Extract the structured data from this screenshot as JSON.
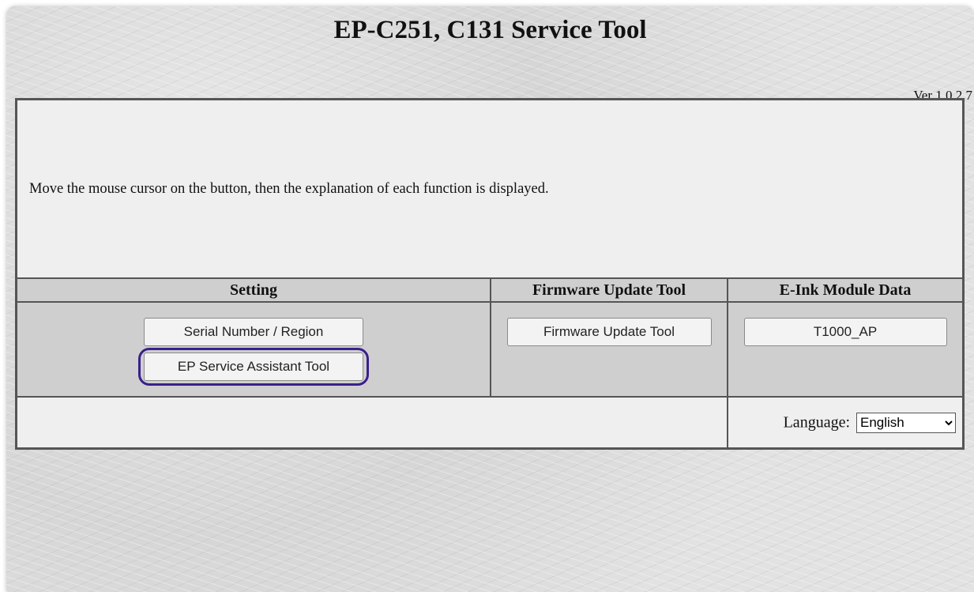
{
  "header": {
    "title": "EP-C251, C131 Service Tool",
    "version": "Ver 1.0.2.7"
  },
  "description": {
    "text": "Move the mouse cursor on the button, then the explanation of each function is displayed."
  },
  "columns": {
    "setting": "Setting",
    "firmware": "Firmware Update Tool",
    "eink": "E-Ink Module Data"
  },
  "buttons": {
    "serial_region": "Serial Number / Region",
    "ep_service_assistant": "EP Service Assistant Tool",
    "firmware_update": "Firmware Update Tool",
    "t1000_ap": "T1000_AP"
  },
  "footer": {
    "language_label": "Language:",
    "language_selected": "English",
    "highlight_color": "#3a1f8c"
  }
}
